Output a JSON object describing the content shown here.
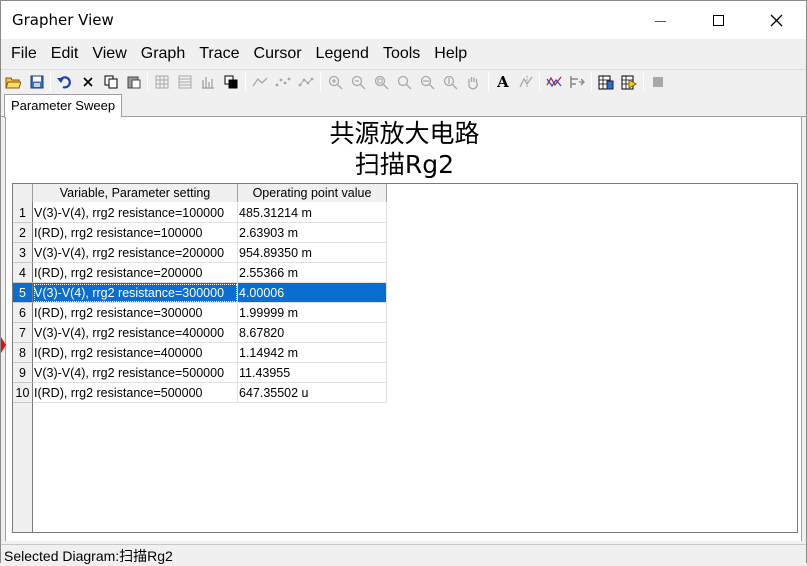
{
  "window": {
    "title": "Grapher View"
  },
  "menu": [
    "File",
    "Edit",
    "View",
    "Graph",
    "Trace",
    "Cursor",
    "Legend",
    "Tools",
    "Help"
  ],
  "toolbar": {
    "icons": [
      "open-icon",
      "save-icon",
      "undo-icon",
      "delete-icon",
      "copy-icon",
      "paste-icon",
      "grid-icon",
      "list-icon",
      "bars-icon",
      "overlay-icon",
      "line-icon",
      "dots-icon",
      "line-dots-icon",
      "zoom-in-icon",
      "zoom-out-icon",
      "zoom-area-icon",
      "zoom-fit-icon",
      "zoom-x-icon",
      "zoom-y-icon",
      "pan-icon",
      "text-icon",
      "cursor-icon",
      "trace-icon",
      "export-icon",
      "table-icon",
      "run-icon",
      "stop-icon"
    ]
  },
  "tabs": [
    {
      "label": "Parameter Sweep"
    }
  ],
  "chart": {
    "title_line1": "共源放大电路",
    "title_line2": "扫描Rg2"
  },
  "table": {
    "columns": [
      "Variable, Parameter setting",
      "Operating point value"
    ],
    "selected_row": 5,
    "rows": [
      {
        "n": "1",
        "param": "V(3)-V(4), rrg2 resistance=100000",
        "value": "485.31214 m"
      },
      {
        "n": "2",
        "param": "I(RD), rrg2 resistance=100000",
        "value": "2.63903 m"
      },
      {
        "n": "3",
        "param": "V(3)-V(4), rrg2 resistance=200000",
        "value": "954.89350 m"
      },
      {
        "n": "4",
        "param": "I(RD), rrg2 resistance=200000",
        "value": "2.55366 m"
      },
      {
        "n": "5",
        "param": "V(3)-V(4), rrg2 resistance=300000",
        "value": "4.00006"
      },
      {
        "n": "6",
        "param": "I(RD), rrg2 resistance=300000",
        "value": "1.99999 m"
      },
      {
        "n": "7",
        "param": "V(3)-V(4), rrg2 resistance=400000",
        "value": "8.67820"
      },
      {
        "n": "8",
        "param": "I(RD), rrg2 resistance=400000",
        "value": "1.14942 m"
      },
      {
        "n": "9",
        "param": "V(3)-V(4), rrg2 resistance=500000",
        "value": "11.43955"
      },
      {
        "n": "10",
        "param": "I(RD), rrg2 resistance=500000",
        "value": "647.35502 u"
      }
    ]
  },
  "status": {
    "text": "Selected Diagram:扫描Rg2"
  },
  "colors": {
    "selection": "#0a6ed1",
    "marker": "#e01010"
  }
}
